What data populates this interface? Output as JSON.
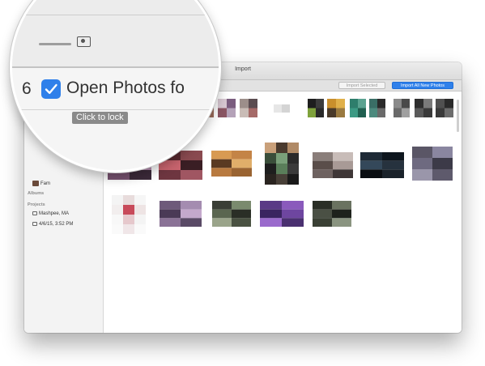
{
  "window": {
    "title": "Import"
  },
  "toolbar": {
    "import_selected_label": "Import Selected",
    "import_all_label": "Import All New Photos"
  },
  "sidebar": {
    "family_label": "Fam",
    "albums_header": "Albums",
    "projects_header": "Projects",
    "projects": [
      {
        "label": "Mashpee, MA"
      },
      {
        "label": "4/6/15, 3:52 PM"
      }
    ]
  },
  "magnifier": {
    "count": "6",
    "checkbox_label": "Open Photos fo",
    "checked": true,
    "tooltip": "Click to lock"
  },
  "colors": {
    "accent": "#2f80ea",
    "window_chrome": "#e2e2e2",
    "sidebar": "#f3f3f3"
  },
  "icons": [
    "photo-icon",
    "checkmark-icon",
    "project-icon"
  ]
}
